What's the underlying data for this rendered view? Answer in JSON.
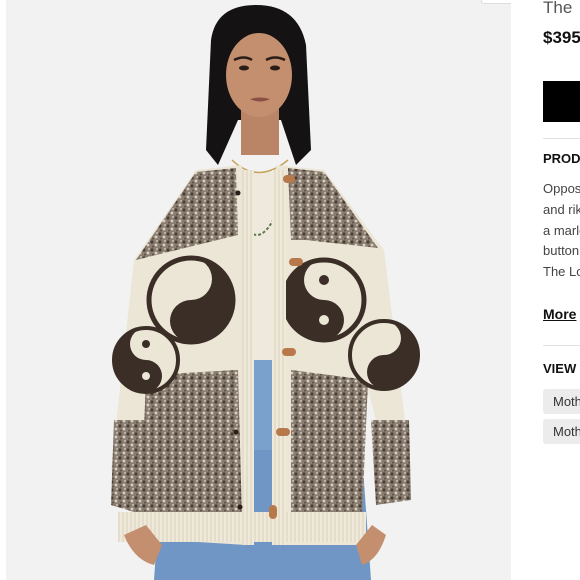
{
  "product": {
    "title": "The",
    "price": "$395",
    "image_alt": "Model wearing a cream and brown marled yin-yang cardigan with toggle buttons"
  },
  "buttons": {
    "add_to_cart_label": ""
  },
  "details": {
    "heading": "PRODU",
    "description_lines": [
      "Oppos",
      "and rik",
      "a marle",
      "button",
      "The Lo"
    ],
    "more_label": "More"
  },
  "view": {
    "heading": "VIEW",
    "chips": [
      "Moth",
      "Moth"
    ]
  },
  "colors": {
    "background": "#f2f2f2",
    "cardigan_cream": "#ece6d6",
    "cardigan_brown": "#4a3d33",
    "button_black": "#000000"
  }
}
